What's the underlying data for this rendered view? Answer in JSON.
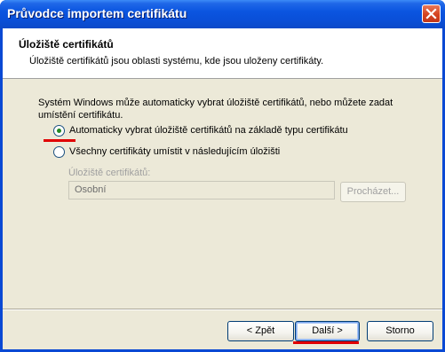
{
  "window": {
    "title": "Průvodce importem certifikátu"
  },
  "header": {
    "title": "Úložiště certifikátů",
    "subtitle": "Úložiště certifikátů jsou oblasti systému, kde jsou uloženy certifikáty."
  },
  "body": {
    "description": "Systém Windows může automaticky vybrat úložiště certifikátů, nebo můžete zadat umístění certifikátu."
  },
  "options": {
    "auto_label": "Automaticky vybrat úložiště certifikátů na základě typu certifikátu",
    "auto_selected": true,
    "manual_label": "Všechny certifikáty umístit v následujícím úložišti",
    "manual_selected": false
  },
  "store": {
    "label": "Úložiště certifikátů:",
    "value": "Osobní",
    "browse_label": "Procházet..."
  },
  "footer": {
    "back_label": "< Zpět",
    "next_label": "Další >",
    "cancel_label": "Storno"
  },
  "colors": {
    "annotation": "#e00000",
    "titlebar": "#0a4fd8"
  }
}
